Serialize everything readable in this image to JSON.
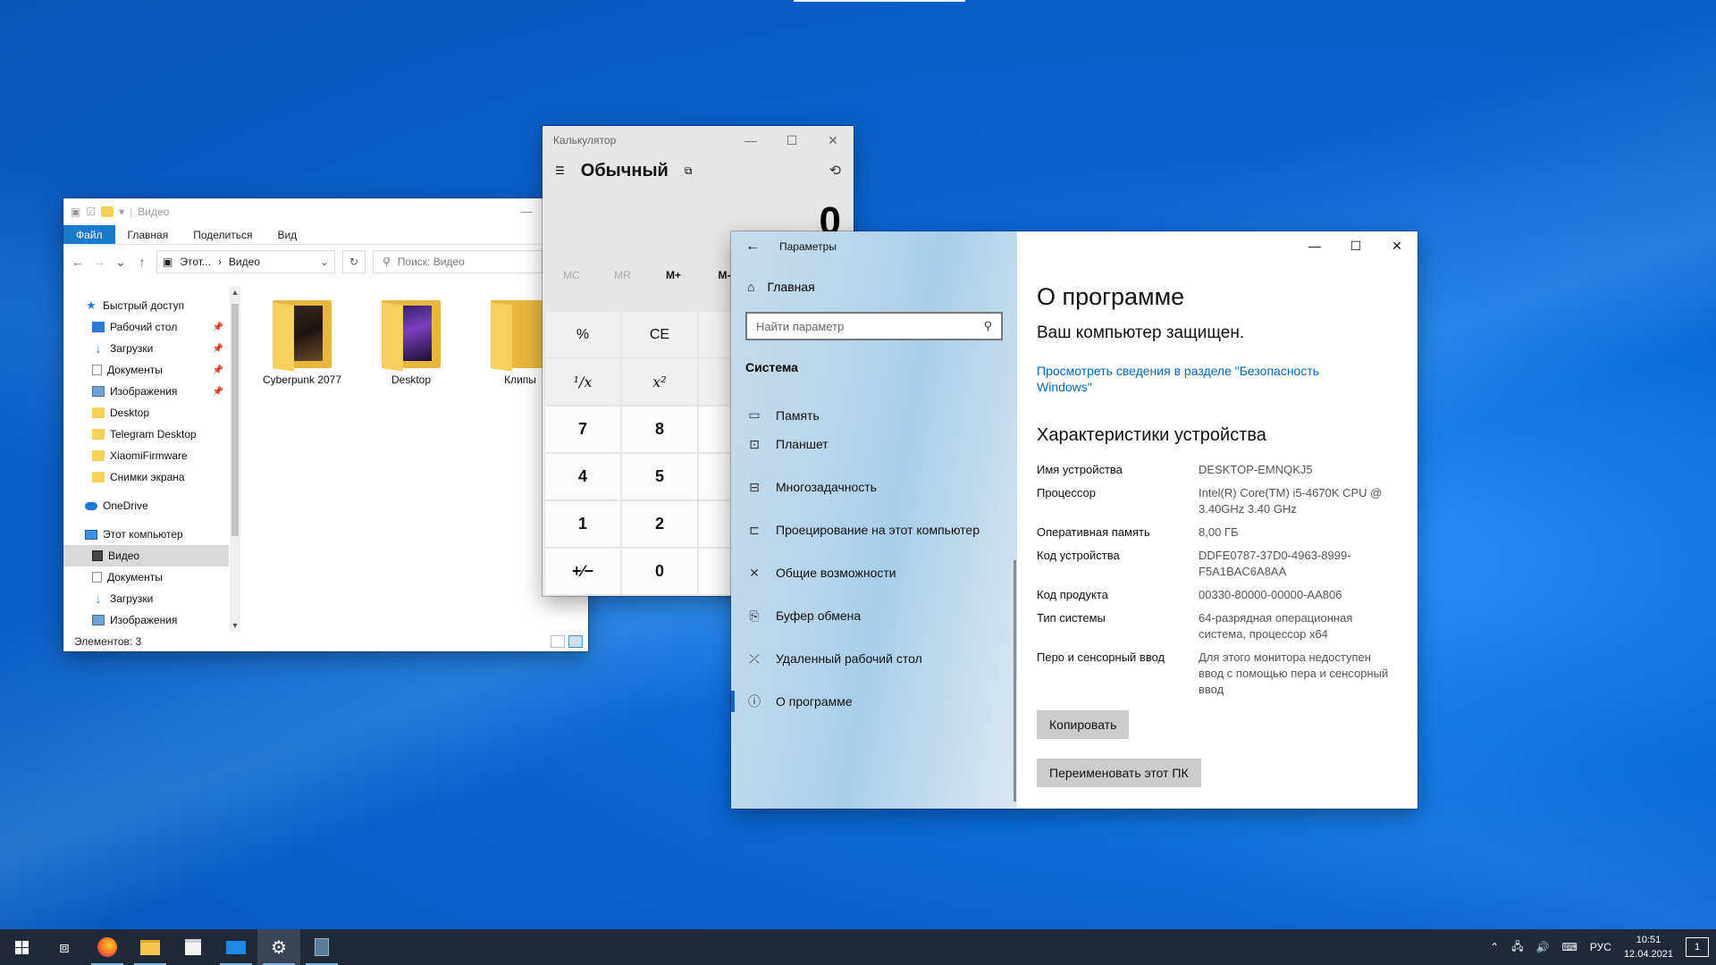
{
  "explorer": {
    "title": "Видео",
    "ribbon_tabs": [
      "Файл",
      "Главная",
      "Поделиться",
      "Вид"
    ],
    "path": [
      "Этот...",
      "Видео"
    ],
    "search_placeholder": "Поиск: Видео",
    "nav": {
      "quick_access": "Быстрый доступ",
      "quick_items": [
        {
          "label": "Рабочий стол",
          "icon": "desktop-icon",
          "pinned": true
        },
        {
          "label": "Загрузки",
          "icon": "downloads-icon",
          "pinned": true
        },
        {
          "label": "Документы",
          "icon": "documents-icon",
          "pinned": true
        },
        {
          "label": "Изображения",
          "icon": "pictures-icon",
          "pinned": true
        },
        {
          "label": "Desktop",
          "icon": "folder-icon",
          "pinned": false
        },
        {
          "label": "Telegram Desktop",
          "icon": "folder-icon",
          "pinned": false
        },
        {
          "label": "XiaomiFirmware",
          "icon": "folder-icon",
          "pinned": false
        },
        {
          "label": "Снимки экрана",
          "icon": "folder-icon",
          "pinned": false
        }
      ],
      "onedrive": "OneDrive",
      "this_pc": "Этот компьютер",
      "pc_items": [
        {
          "label": "Видео",
          "icon": "videos-icon",
          "selected": true
        },
        {
          "label": "Документы",
          "icon": "documents-icon",
          "selected": false
        },
        {
          "label": "Загрузки",
          "icon": "downloads-icon",
          "selected": false
        },
        {
          "label": "Изображения",
          "icon": "pictures-icon",
          "selected": false
        }
      ]
    },
    "files": [
      {
        "label": "Cyberpunk 2077"
      },
      {
        "label": "Desktop"
      },
      {
        "label": "Клипы"
      }
    ],
    "status": "Элементов: 3"
  },
  "calculator": {
    "title": "Калькулятор",
    "mode": "Обычный",
    "display": "0",
    "memory": [
      "MC",
      "MR",
      "M+",
      "M-"
    ],
    "keys": [
      "%",
      "CE",
      "",
      "",
      "",
      "¹∕x",
      "x²",
      "",
      "",
      "",
      "7",
      "8",
      "",
      "",
      "",
      "4",
      "5",
      "",
      "",
      "",
      "1",
      "2",
      "",
      "",
      "",
      "+∕−",
      "0",
      "",
      "",
      ""
    ]
  },
  "settings": {
    "title": "Параметры",
    "home": "Главная",
    "search_placeholder": "Найти параметр",
    "section": "Система",
    "nav": [
      {
        "label": "Память",
        "glyph": "▭"
      },
      {
        "label": "Планшет",
        "glyph": "⊡"
      },
      {
        "label": "Многозадачность",
        "glyph": "⊟"
      },
      {
        "label": "Проецирование на этот компьютер",
        "glyph": "⊏"
      },
      {
        "label": "Общие возможности",
        "glyph": "✕"
      },
      {
        "label": "Буфер обмена",
        "glyph": "⎘"
      },
      {
        "label": "Удаленный рабочий стол",
        "glyph": "⤫"
      },
      {
        "label": "О программе",
        "glyph": "ⓘ"
      }
    ],
    "page_title": "О программе",
    "protected": "Ваш компьютер защищен.",
    "security_link": "Просмотреть сведения в разделе \"Безопасность Windows\"",
    "specs_title": "Характеристики устройства",
    "specs": [
      {
        "key": "Имя устройства",
        "value": "DESKTOP-EMNQKJ5"
      },
      {
        "key": "Процессор",
        "value": "Intel(R) Core(TM) i5-4670K CPU @ 3.40GHz   3.40 GHz"
      },
      {
        "key": "Оперативная память",
        "value": "8,00 ГБ"
      },
      {
        "key": "Код устройства",
        "value": "DDFE0787-37D0-4963-8999-F5A1BAC6A8AA"
      },
      {
        "key": "Код продукта",
        "value": "00330-80000-00000-AA806"
      },
      {
        "key": "Тип системы",
        "value": "64-разрядная операционная система, процессор x64"
      },
      {
        "key": "Перо и сенсорный ввод",
        "value": "Для этого монитора недоступен ввод с помощью пера и сенсорный ввод"
      }
    ],
    "copy_button": "Копировать",
    "rename_button": "Переименовать этот ПК"
  },
  "taskbar": {
    "apps": [
      {
        "name": "firefox-icon",
        "running": true
      },
      {
        "name": "file-explorer-icon",
        "running": true
      },
      {
        "name": "store-icon",
        "running": false
      },
      {
        "name": "mail-icon",
        "running": true
      },
      {
        "name": "settings-icon",
        "running": true
      },
      {
        "name": "calculator-icon",
        "running": true
      }
    ],
    "language": "РУС",
    "time": "10:51",
    "date": "12.04.2021",
    "notifications": "1"
  },
  "colors": {
    "accent": "#0067c0",
    "ribbon_file": "#1979ca",
    "taskbar": "#1f2a38"
  }
}
